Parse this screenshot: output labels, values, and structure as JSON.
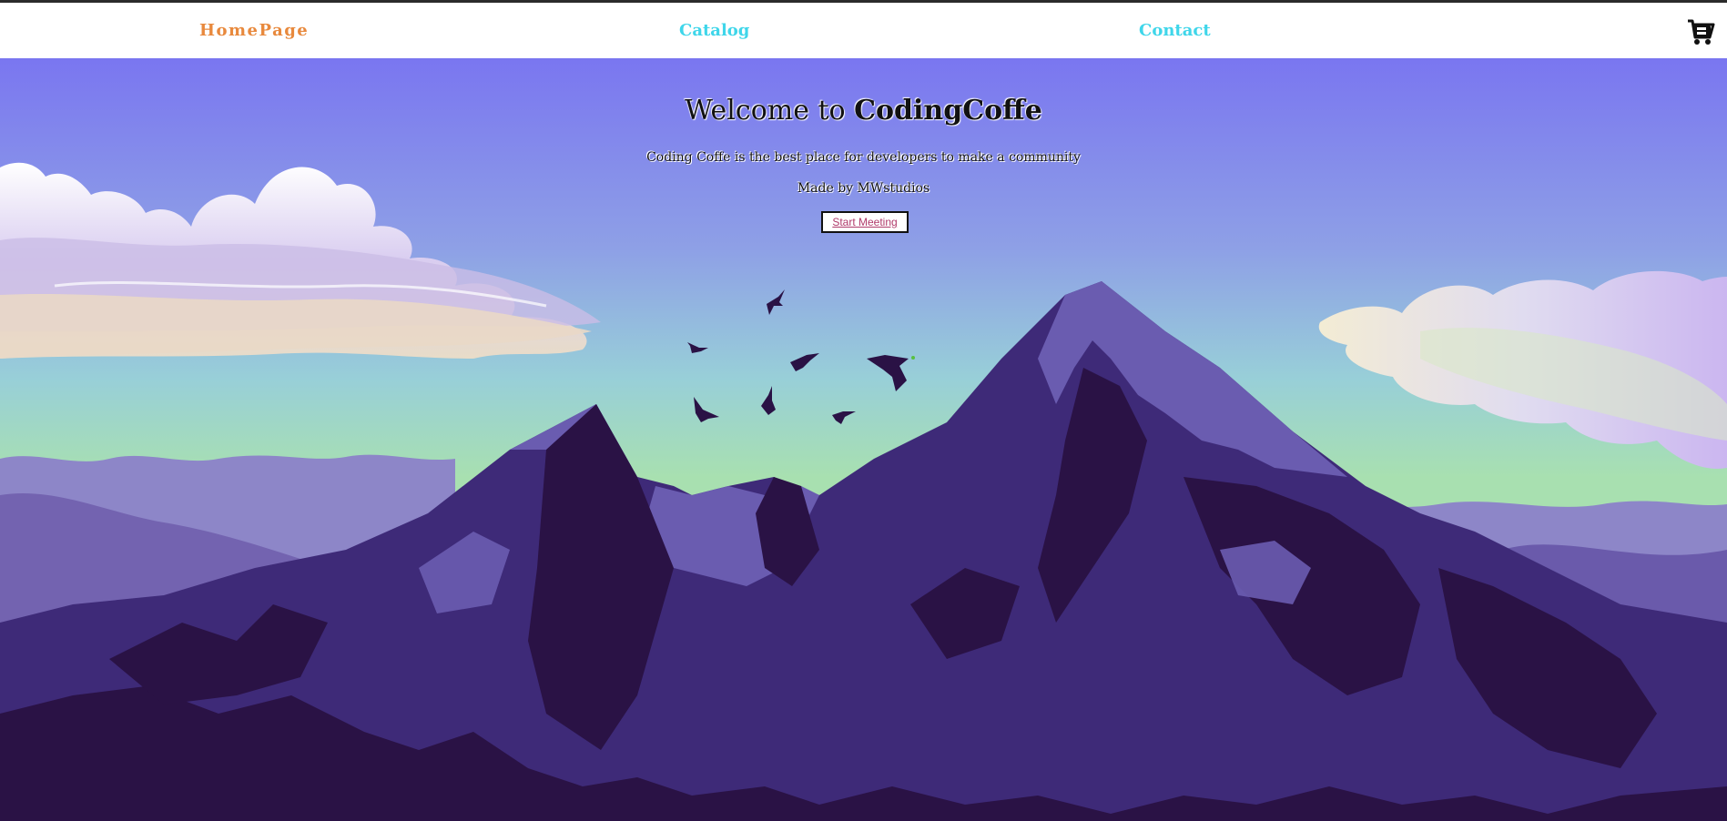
{
  "nav": {
    "home": "HomePage",
    "catalog": "Catalog",
    "contact": "Contact",
    "cart_icon": "shopping-cart-icon"
  },
  "hero": {
    "title_prefix": "Welcome to",
    "title_brand": "CodingCoffe",
    "description": "Coding Coffe is the best place for developers to make a community",
    "credit": "Made by MWstudios",
    "button": "Start Meeting"
  },
  "colors": {
    "home_link": "#e8893d",
    "nav_link": "#3fd6ea",
    "sky_top": "#7a76f0",
    "sky_bottom": "#a8e0b0",
    "mountain_dark": "#2a1245",
    "mountain_mid": "#3e2a78",
    "mountain_light": "#6a5cb0"
  }
}
